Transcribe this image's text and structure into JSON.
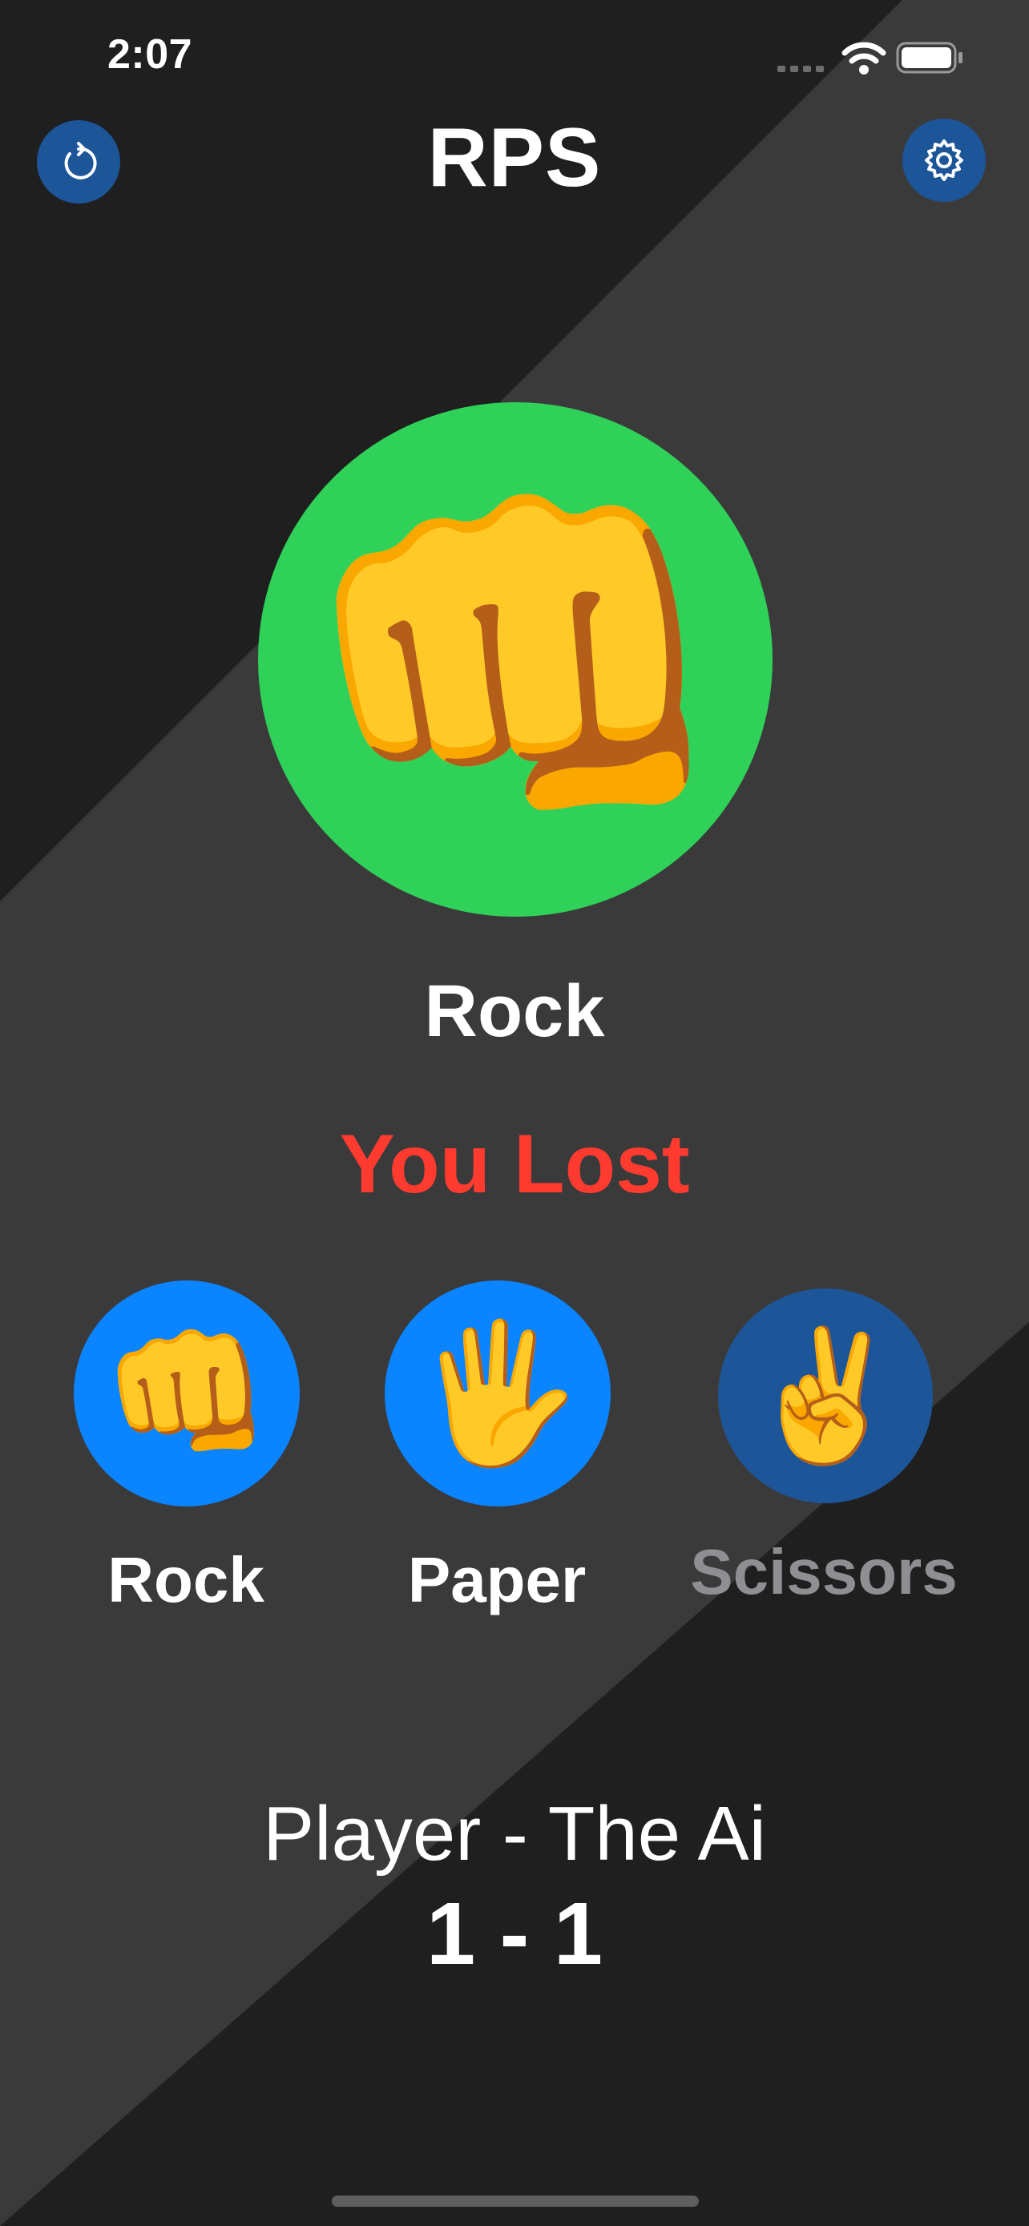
{
  "status_bar": {
    "time": "2:07"
  },
  "header": {
    "title": "RPS"
  },
  "opponent": {
    "emoji": "👊",
    "label": "Rock"
  },
  "result": {
    "text": "You Lost",
    "color": "#ff3b30"
  },
  "options": [
    {
      "emoji": "👊",
      "label": "Rock",
      "enabled": true
    },
    {
      "emoji": "🖐️",
      "label": "Paper",
      "enabled": true
    },
    {
      "emoji": "✌️",
      "label": "Scissors",
      "enabled": false
    }
  ],
  "score": {
    "title": "Player - The Ai",
    "value": "1 - 1"
  },
  "colors": {
    "accent": "#0a84ff",
    "accent_dim": "#1d5599",
    "win_circle": "#30d158",
    "background_dark": "#1f1f20",
    "background_band": "#3a3a3b"
  },
  "icons": [
    "reset-icon",
    "settings-gear-icon",
    "signal-icon",
    "wifi-icon",
    "battery-icon"
  ]
}
